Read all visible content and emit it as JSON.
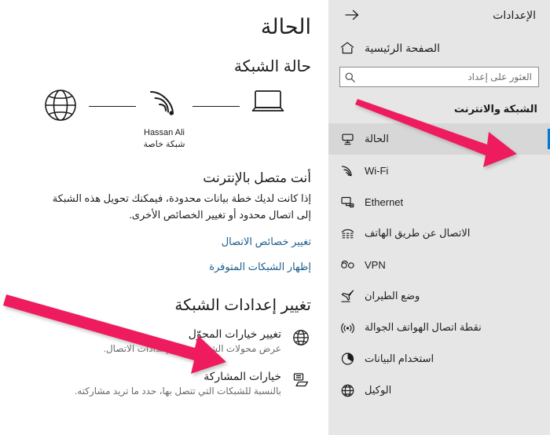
{
  "sidebar": {
    "back_icon": "back-arrow-icon",
    "app_title": "الإعدادات",
    "home": {
      "icon": "home-icon",
      "label": "الصفحة الرئيسية"
    },
    "search": {
      "placeholder": "العثور على إعداد",
      "value": "",
      "icon": "search-icon"
    },
    "group_title": "الشبكة والانترنت",
    "accent_color": "#0078d7",
    "background_color": "#e6e6e6",
    "items": [
      {
        "label": "الحالة",
        "icon": "status-icon",
        "selected": true
      },
      {
        "label": "Wi-Fi",
        "icon": "wifi-icon",
        "selected": false,
        "ltr": true
      },
      {
        "label": "Ethernet",
        "icon": "ethernet-icon",
        "selected": false,
        "ltr": true
      },
      {
        "label": "الاتصال عن طريق الهاتف",
        "icon": "dialup-phone-icon",
        "selected": false
      },
      {
        "label": "VPN",
        "icon": "vpn-icon",
        "selected": false,
        "ltr": true
      },
      {
        "label": "وضع الطيران",
        "icon": "airplane-icon",
        "selected": false
      },
      {
        "label": "نقطة اتصال الهواتف الجوالة",
        "icon": "mobile-hotspot-icon",
        "selected": false
      },
      {
        "label": "استخدام البيانات",
        "icon": "data-usage-icon",
        "selected": false
      },
      {
        "label": "الوكيل",
        "icon": "proxy-globe-icon",
        "selected": false
      }
    ]
  },
  "main": {
    "page_title": "الحالة",
    "section_title": "حالة الشبكة",
    "diagram": {
      "globe_icon": "globe-icon",
      "wifi_icon": "wifi-signal-icon",
      "device_icon": "laptop-icon",
      "network_name": "Hassan Ali",
      "network_type": "شبكة خاصة"
    },
    "status_heading": "أنت متصل بالإنترنت",
    "status_description": "إذا كانت لديك خطة بيانات محدودة، فيمكنك تحويل هذه الشبكة إلى اتصال محدود أو تغيير الخصائص الأخرى.",
    "links": [
      {
        "label": "تغيير خصائص الاتصال",
        "color": "#1b5e8e"
      },
      {
        "label": "إظهار الشبكات المتوفرة",
        "color": "#1b5e8e"
      }
    ],
    "change_settings_title": "تغيير إعدادات الشبكة",
    "settings": [
      {
        "icon": "adapter-globe-icon",
        "title": "تغيير خيارات المحوّل",
        "subtitle": "عرض محولات الشبكة وتغيير إعدادات الاتصال."
      },
      {
        "icon": "sharing-icon",
        "title": "خيارات المشاركة",
        "subtitle": "بالنسبة للشبكات التي تتصل بها، حدد ما تريد مشاركته."
      }
    ]
  },
  "annotations": {
    "color": "#ee1a5f",
    "arrows": [
      {
        "name": "arrow-to-status-nav-item",
        "points_to": "الحالة"
      },
      {
        "name": "arrow-to-change-adapter-options",
        "points_to": "تغيير خيارات المحوّل"
      }
    ]
  }
}
